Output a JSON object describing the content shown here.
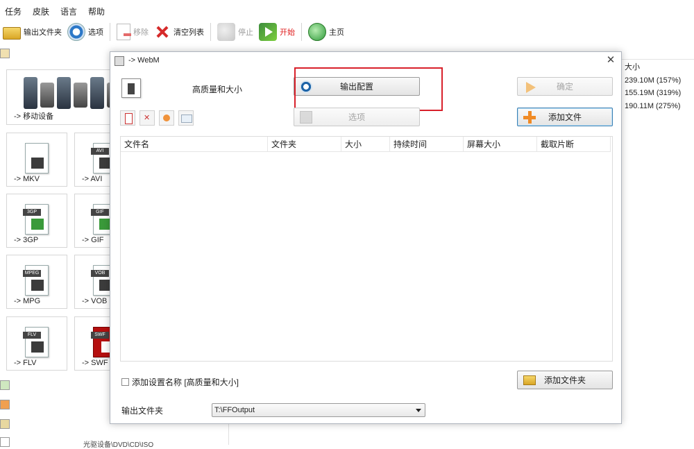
{
  "menu": {
    "items": [
      "任务",
      "皮肤",
      "语言",
      "帮助"
    ]
  },
  "toolbar": {
    "output_folder": "输出文件夹",
    "options": "选项",
    "remove": "移除",
    "clear_list": "清空列表",
    "stop": "停止",
    "start": "开始",
    "home": "主页"
  },
  "left": {
    "tiles": {
      "mobile": "-> 移动设备",
      "mkv": "-> MKV",
      "avi": "-> AVI",
      "gp3": "-> 3GP",
      "gif": "-> GIF",
      "mpg": "-> MPG",
      "vob": "-> VOB",
      "flv": "-> FLV",
      "swf": "-> SWF"
    },
    "badges": {
      "avi": "AVI",
      "gif": "GIF",
      "mpeg": "MPEG",
      "vob": "VOB",
      "flv": "FLV",
      "swf": "SWF",
      "gp3": "3GP"
    },
    "bottom_label": "光驱设备\\DVD\\CD\\ISO"
  },
  "list": {
    "size_header": "大小",
    "sizes": [
      "239.10M  (157%)",
      "155.19M  (319%)",
      "190.11M  (275%)"
    ]
  },
  "dialog": {
    "title": "-> WebM",
    "quality": "高质量和大小",
    "output_config": "输出配置",
    "options": "选项",
    "ok": "确定",
    "add_file": "添加文件",
    "add_folder": "添加文件夹",
    "columns": [
      "文件名",
      "文件夹",
      "大小",
      "持续时间",
      "屏幕大小",
      "截取片断"
    ],
    "checkbox_label": "添加设置名称 [高质量和大小]",
    "output_folder_label": "输出文件夹",
    "output_folder_value": "T:\\FFOutput"
  },
  "colors": {
    "highlight": "#d8202a",
    "primary_border": "#3c7fb1"
  }
}
